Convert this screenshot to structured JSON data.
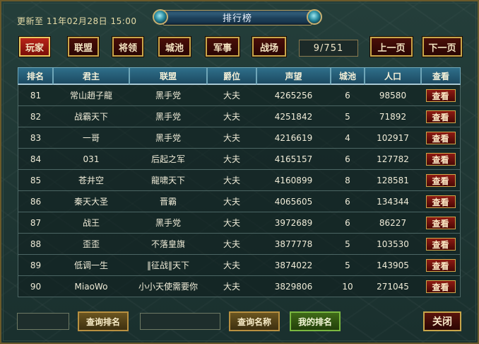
{
  "header": {
    "update_text": "更新至 11年02月28日 15:00",
    "title": "排行榜"
  },
  "tabs": [
    {
      "label": "玩家",
      "active": true
    },
    {
      "label": "联盟",
      "active": false
    },
    {
      "label": "将领",
      "active": false
    },
    {
      "label": "城池",
      "active": false
    },
    {
      "label": "军事",
      "active": false
    },
    {
      "label": "战场",
      "active": false
    }
  ],
  "pagination": {
    "indicator": "9/751",
    "prev_label": "上一页",
    "next_label": "下一页"
  },
  "table": {
    "columns": [
      "排名",
      "君主",
      "联盟",
      "爵位",
      "声望",
      "城池",
      "人口",
      "查看"
    ],
    "rows": [
      {
        "rank": "81",
        "lord": "常山趙子龍",
        "alliance": "黑手党",
        "title": "大夫",
        "prestige": "4265256",
        "cities": "6",
        "population": "98580",
        "view": "查看"
      },
      {
        "rank": "82",
        "lord": "战霸天下",
        "alliance": "黑手党",
        "title": "大夫",
        "prestige": "4251842",
        "cities": "5",
        "population": "71892",
        "view": "查看"
      },
      {
        "rank": "83",
        "lord": "一哥",
        "alliance": "黑手党",
        "title": "大夫",
        "prestige": "4216619",
        "cities": "4",
        "population": "102917",
        "view": "查看"
      },
      {
        "rank": "84",
        "lord": "031",
        "alliance": "后起之军",
        "title": "大夫",
        "prestige": "4165157",
        "cities": "6",
        "population": "127782",
        "view": "查看"
      },
      {
        "rank": "85",
        "lord": "苍井空",
        "alliance": "龍啸天下",
        "title": "大夫",
        "prestige": "4160899",
        "cities": "8",
        "population": "128581",
        "view": "查看"
      },
      {
        "rank": "86",
        "lord": "秦天大圣",
        "alliance": "晋霸",
        "title": "大夫",
        "prestige": "4065605",
        "cities": "6",
        "population": "134344",
        "view": "查看"
      },
      {
        "rank": "87",
        "lord": "战王",
        "alliance": "黑手党",
        "title": "大夫",
        "prestige": "3972689",
        "cities": "6",
        "population": "86227",
        "view": "查看"
      },
      {
        "rank": "88",
        "lord": "歪歪",
        "alliance": "不落皇旗",
        "title": "大夫",
        "prestige": "3877778",
        "cities": "5",
        "population": "103530",
        "view": "查看"
      },
      {
        "rank": "89",
        "lord": "低调一生",
        "alliance": "‖征战‖天下",
        "title": "大夫",
        "prestige": "3874022",
        "cities": "5",
        "population": "143905",
        "view": "查看"
      },
      {
        "rank": "90",
        "lord": "MiaoWo",
        "alliance": "小小天使需要你",
        "title": "大夫",
        "prestige": "3829806",
        "cities": "10",
        "population": "271045",
        "view": "查看"
      }
    ]
  },
  "footer": {
    "rank_query_value": "",
    "query_rank_label": "查询排名",
    "name_query_value": "",
    "query_name_label": "查询名称",
    "my_rank_label": "我的排名",
    "close_label": "关闭"
  }
}
